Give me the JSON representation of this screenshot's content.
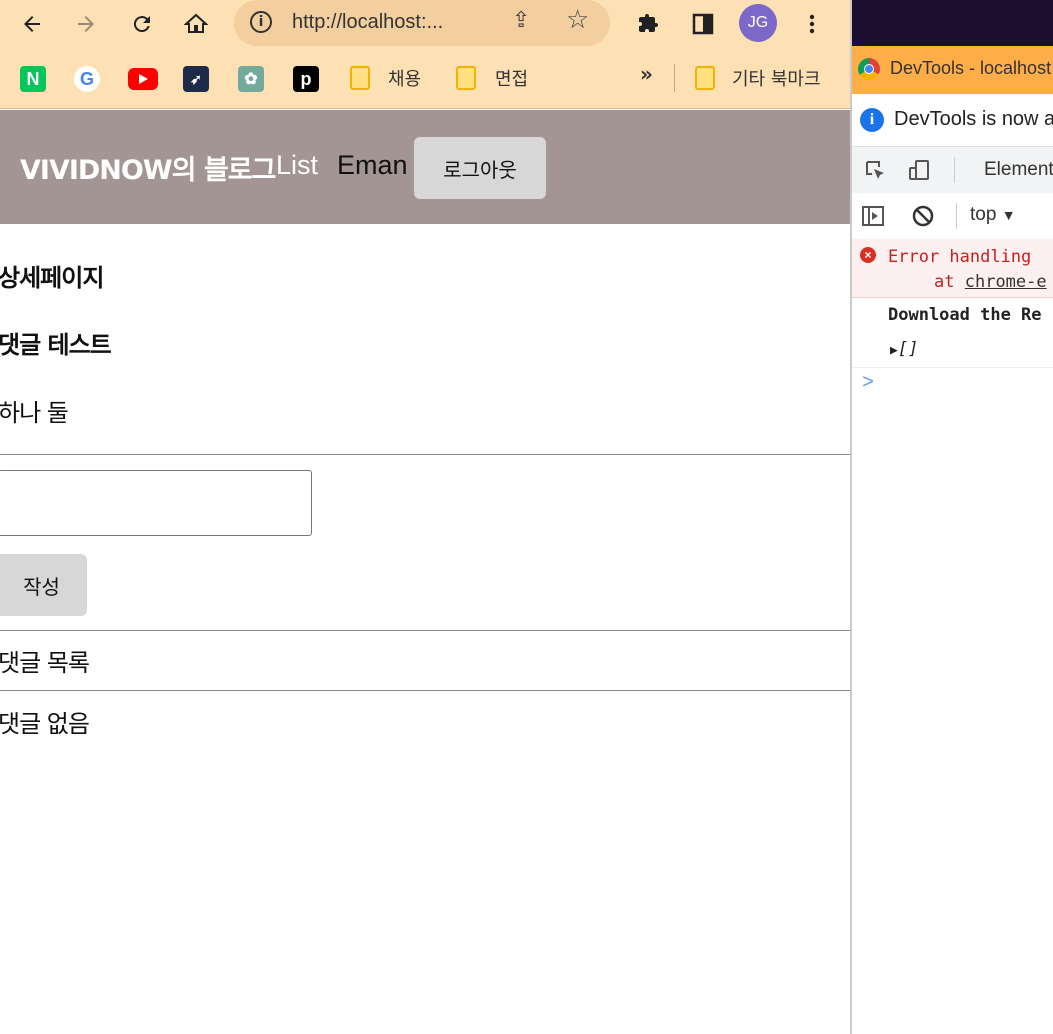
{
  "browser": {
    "url": "http://localhost:...",
    "profile_initials": "JG",
    "bookmarks": {
      "folder1": "채용",
      "folder2": "면접",
      "more": "»",
      "other": "기타 북마크"
    },
    "icons": [
      "back-icon",
      "forward-icon",
      "reload-icon",
      "home-icon",
      "info-icon",
      "share-icon",
      "star-icon",
      "extensions-icon",
      "sidepanel-icon",
      "menu-icon"
    ]
  },
  "page": {
    "navbar": {
      "brand": "VIVIDNOW의 블로그",
      "list": "List",
      "user": "Eman",
      "logout": "로그아웃"
    },
    "detail_heading": "상세페이지",
    "post_title": "댓글 테스트",
    "post_body": "하나 둘",
    "comment_input_value": "",
    "submit_label": "작성",
    "comments_heading": "댓글 목록",
    "no_comments": "댓글 없음"
  },
  "devtools": {
    "title": "DevTools - localhost",
    "info_banner": "DevTools is now a",
    "tab_elements": "Elements",
    "context": "top",
    "error_line1": "Error handling",
    "error_line2_prefix": "at",
    "error_line2_link": "chrome-e",
    "log_line": "Download the Re",
    "log_array": "[]",
    "prompt": ">"
  },
  "colors": {
    "toolbar": "#fde0b4",
    "navbar": "#a39593",
    "button": "#d7d7d7",
    "devtools_title": "#ffad47",
    "error": "#c5221f"
  }
}
